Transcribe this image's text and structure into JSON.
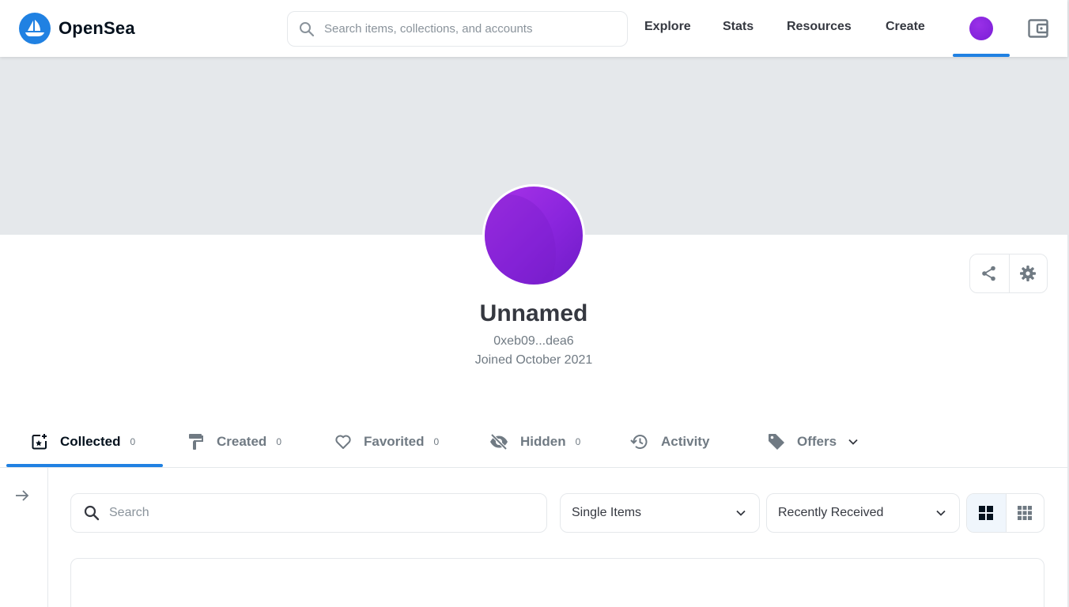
{
  "header": {
    "brand": "OpenSea",
    "search_placeholder": "Search items, collections, and accounts",
    "nav": [
      "Explore",
      "Stats",
      "Resources",
      "Create"
    ],
    "accent_color": "#2081e2"
  },
  "profile": {
    "name": "Unnamed",
    "address": "0xeb09...dea6",
    "joined": "Joined October 2021",
    "avatar_color": "#8a25dd",
    "banner_color": "#e5e8eb"
  },
  "tabs": [
    {
      "label": "Collected",
      "count": "0",
      "icon": "collected-icon",
      "active": true
    },
    {
      "label": "Created",
      "count": "0",
      "icon": "paint-roller-icon"
    },
    {
      "label": "Favorited",
      "count": "0",
      "icon": "heart-icon"
    },
    {
      "label": "Hidden",
      "count": "0",
      "icon": "eye-off-icon"
    },
    {
      "label": "Activity",
      "icon": "history-icon"
    },
    {
      "label": "Offers",
      "icon": "tag-icon"
    }
  ],
  "filters": {
    "search_placeholder": "Search",
    "item_type": "Single Items",
    "sort": "Recently Received"
  }
}
